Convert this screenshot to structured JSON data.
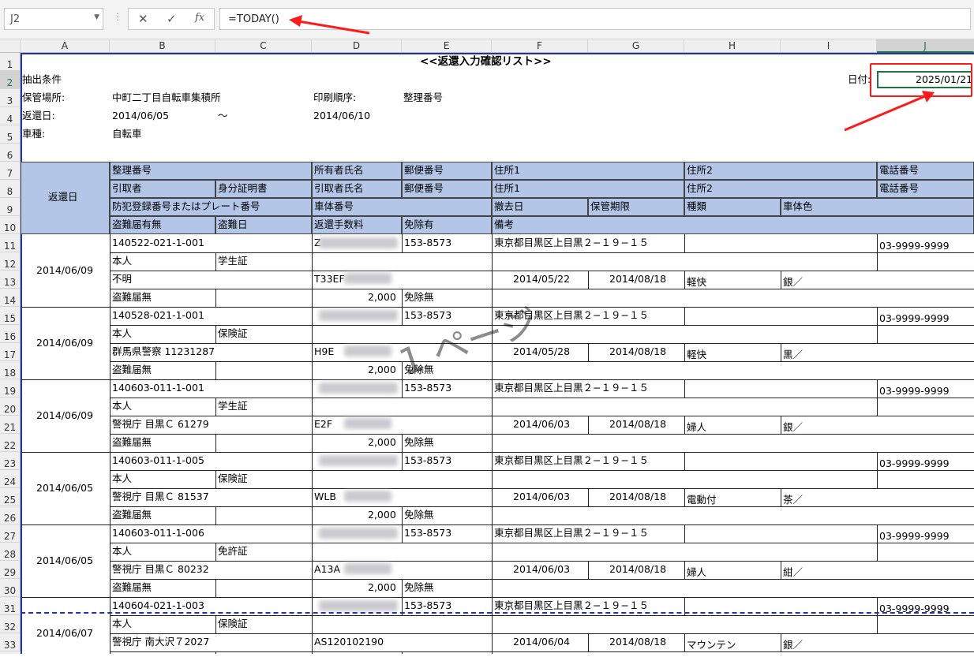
{
  "formula_bar": {
    "name_box": "J2",
    "cancel_icon": "✕",
    "enter_icon": "✓",
    "fx_label": "fx",
    "formula": "=TODAY()"
  },
  "columns": [
    "A",
    "B",
    "C",
    "D",
    "E",
    "F",
    "G",
    "H",
    "I",
    "J"
  ],
  "rows": [
    "1",
    "2",
    "3",
    "4",
    "5",
    "6",
    "7",
    "8",
    "9",
    "10",
    "11",
    "12",
    "13",
    "14",
    "15",
    "16",
    "17",
    "18",
    "19",
    "20",
    "21",
    "22",
    "23",
    "24",
    "25",
    "26",
    "27",
    "28",
    "29",
    "30",
    "31",
    "32",
    "33"
  ],
  "sheet": {
    "title": "<<返還入力確認リスト>>",
    "date_label": "日付:",
    "date_value": "2025/01/21",
    "conditions_label": "抽出条件",
    "storage_label": "保管場所:",
    "storage_value": "中町二丁目自転車集積所",
    "print_order_label": "印刷順序:",
    "print_order_value": "整理番号",
    "return_date_label": "返還日:",
    "return_date_from": "2014/06/05",
    "return_date_tilde": "～",
    "return_date_to": "2014/06/10",
    "vehicle_type_label": "車種:",
    "vehicle_type_value": "自転車"
  },
  "table_header": {
    "return_date": "返還日",
    "r7": [
      "整理番号",
      "所有者氏名",
      "郵便番号",
      "住所1",
      "住所2",
      "電話番号"
    ],
    "r8": [
      "引取者",
      "身分証明書",
      "引取者氏名",
      "郵便番号",
      "住所1",
      "住所2",
      "電話番号"
    ],
    "r9": [
      "防犯登録番号またはプレート番号",
      "車体番号",
      "撤去日",
      "保管期限",
      "種類",
      "車体色"
    ],
    "r10": [
      "盗難届有無",
      "盗難日",
      "返還手数料",
      "免除有",
      "備考"
    ]
  },
  "watermark": "1 ページ",
  "records": [
    {
      "date": "2014/06/09",
      "id": "140522-021-1-001",
      "owner": "Z",
      "postal": "153-8573",
      "address": "東京都目黒区上目黒２−１９−１５",
      "phone": "03-9999-9999",
      "taker": "本人",
      "idcard": "学生証",
      "reg": "不明",
      "frame": "T33EF",
      "removed": "2014/05/22",
      "limit": "2014/08/18",
      "kind": "軽快",
      "color": "銀／",
      "theft": "盗難届無",
      "fee": "2,000",
      "exempt": "免除無"
    },
    {
      "date": "2014/06/09",
      "id": "140528-021-1-001",
      "owner": "",
      "postal": "153-8573",
      "address": "東京都目黒区上目黒２−１９−１５",
      "phone": "03-9999-9999",
      "taker": "本人",
      "idcard": "保険証",
      "reg": "群馬県警察 11231287",
      "frame": "H9E",
      "removed": "2014/05/28",
      "limit": "2014/08/18",
      "kind": "軽快",
      "color": "黒／",
      "theft": "盗難届無",
      "fee": "2,000",
      "exempt": "免除無"
    },
    {
      "date": "2014/06/09",
      "id": "140603-011-1-001",
      "owner": "",
      "postal": "153-8573",
      "address": "東京都目黒区上目黒２−１９−１５",
      "phone": "03-9999-9999",
      "taker": "本人",
      "idcard": "学生証",
      "reg": "警視庁 目黒Ｃ 61279",
      "frame": "E2F",
      "removed": "2014/06/03",
      "limit": "2014/08/18",
      "kind": "婦人",
      "color": "銀／",
      "theft": "盗難届無",
      "fee": "2,000",
      "exempt": "免除無"
    },
    {
      "date": "2014/06/05",
      "id": "140603-011-1-005",
      "owner": "",
      "postal": "153-8573",
      "address": "東京都目黒区上目黒２−１９−１５",
      "phone": "03-9999-9999",
      "taker": "本人",
      "idcard": "保険証",
      "reg": "警視庁 目黒Ｃ 81537",
      "frame": "WLB",
      "removed": "2014/06/03",
      "limit": "2014/08/18",
      "kind": "電動付",
      "color": "茶／",
      "theft": "盗難届無",
      "fee": "2,000",
      "exempt": "免除無"
    },
    {
      "date": "2014/06/05",
      "id": "140603-011-1-006",
      "owner": "",
      "postal": "153-8573",
      "address": "東京都目黒区上目黒２−１９−１５",
      "phone": "03-9999-9999",
      "taker": "本人",
      "idcard": "免許証",
      "reg": "警視庁 目黒Ｃ 80232",
      "frame": "A13A",
      "removed": "2014/06/03",
      "limit": "2014/08/18",
      "kind": "婦人",
      "color": "紺／",
      "theft": "盗難届無",
      "fee": "2,000",
      "exempt": "免除無"
    },
    {
      "date": "2014/06/07",
      "id": "140604-021-1-003",
      "owner": "",
      "postal": "153-8573",
      "address": "東京都目黒区上目黒２−１９−１５",
      "phone": "03-9999-9999",
      "taker": "本人",
      "idcard": "保険証",
      "reg": "警視庁 南大沢７2027",
      "frame": "AS120102190",
      "removed": "2014/06/04",
      "limit": "2014/08/18",
      "kind": "マウンテン",
      "color": "銀／",
      "theft": "",
      "fee": "",
      "exempt": ""
    }
  ],
  "colors": {
    "header_fill": "#b4c6e7",
    "annotation_red": "#ff1a1a",
    "print_area_border": "#2233aa"
  }
}
